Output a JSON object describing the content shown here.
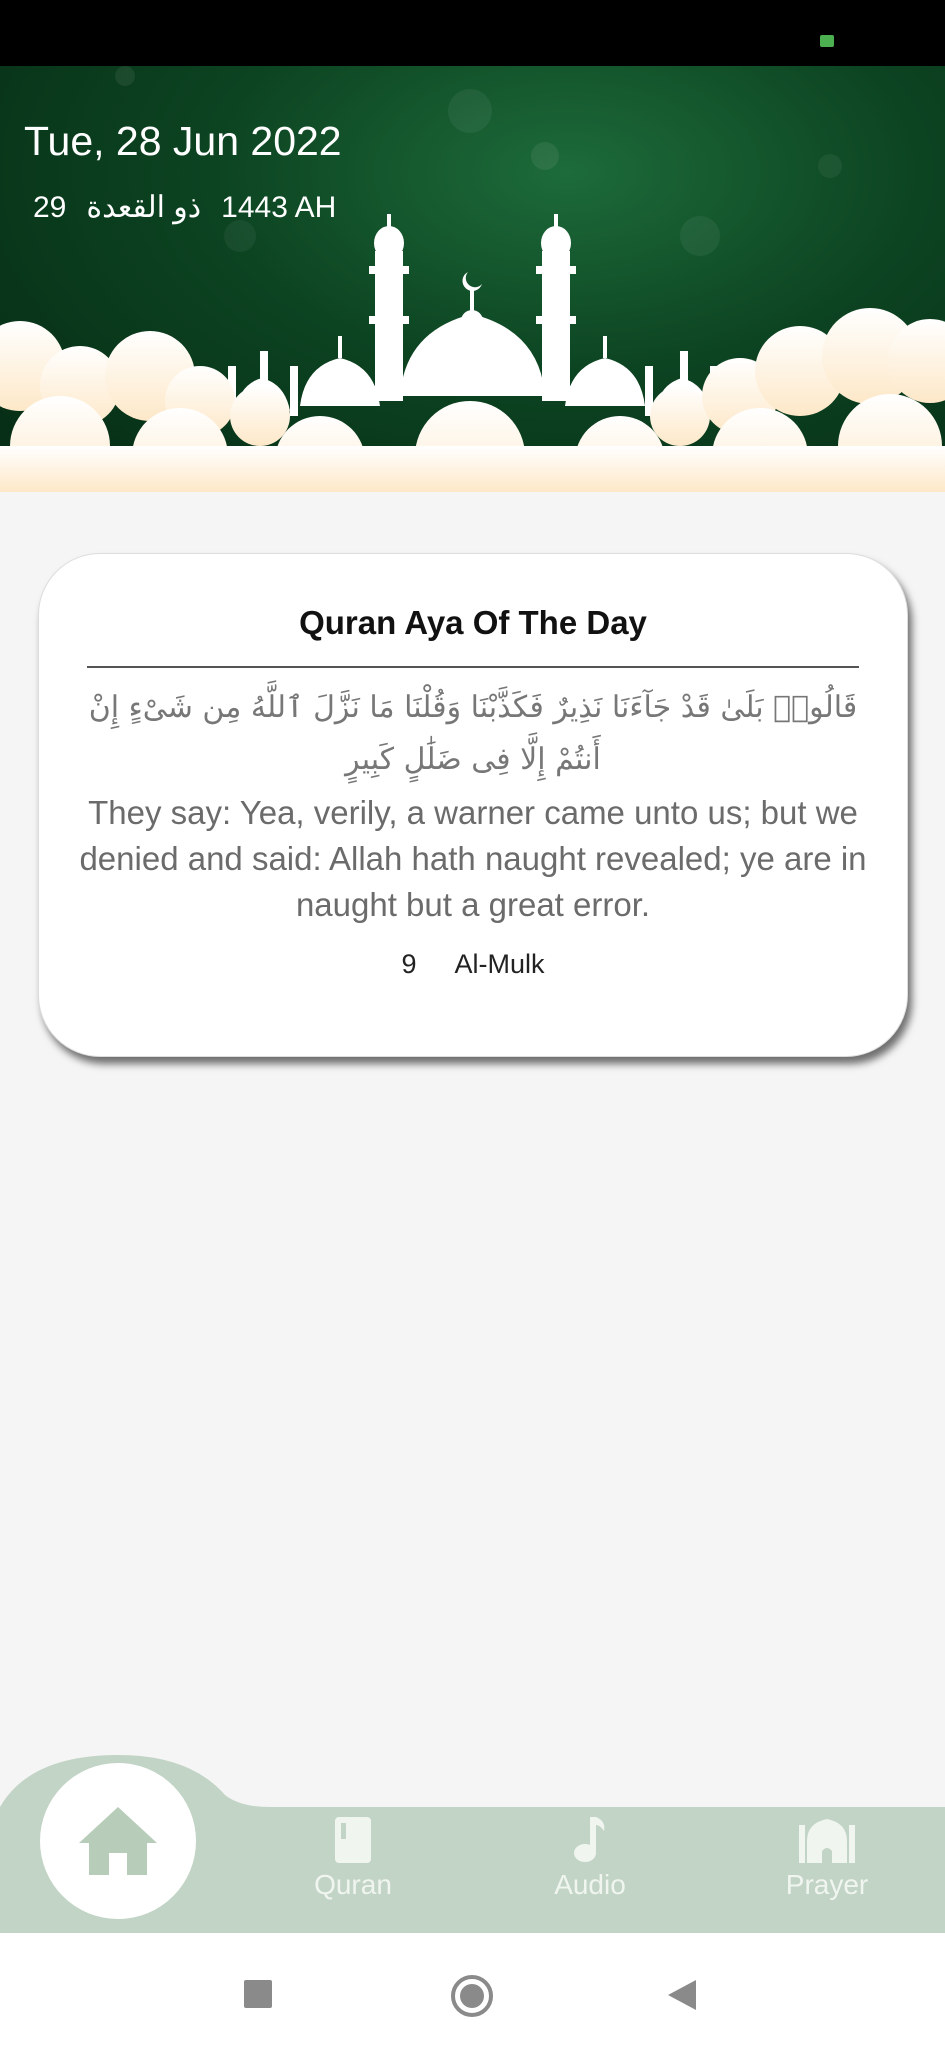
{
  "header": {
    "date": "Tue, 28 Jun 2022",
    "hijri_day": "29",
    "hijri_month": "ذو القعدة",
    "hijri_year": "1443 AH"
  },
  "card": {
    "title": "Quran Aya Of The Day",
    "arabic": "قَالُوا۟ بَلَىٰ قَدْ جَآءَنَا نَذِيرٌ فَكَذَّبْنَا وَقُلْنَا مَا نَزَّلَ ٱللَّهُ مِن شَىْءٍ إِنْ أَنتُمْ إِلَّا فِى ضَلَٰلٍ كَبِيرٍ",
    "translation": "They say: Yea, verily, a warner came unto us; but we denied and said: Allah hath naught revealed; ye are in naught but a great error.",
    "verse_number": "9",
    "surah_name": "Al-Mulk"
  },
  "bottom_nav": {
    "items": [
      {
        "label": "",
        "icon": "home-icon",
        "active": true
      },
      {
        "label": "Quran",
        "icon": "book-icon",
        "active": false
      },
      {
        "label": "Audio",
        "icon": "music-note-icon",
        "active": false
      },
      {
        "label": "Prayer",
        "icon": "mosque-icon",
        "active": false
      }
    ]
  },
  "colors": {
    "header_green": "#0c4321",
    "nav_bg": "#c2d4c5",
    "home_icon": "#b8cdb9"
  }
}
